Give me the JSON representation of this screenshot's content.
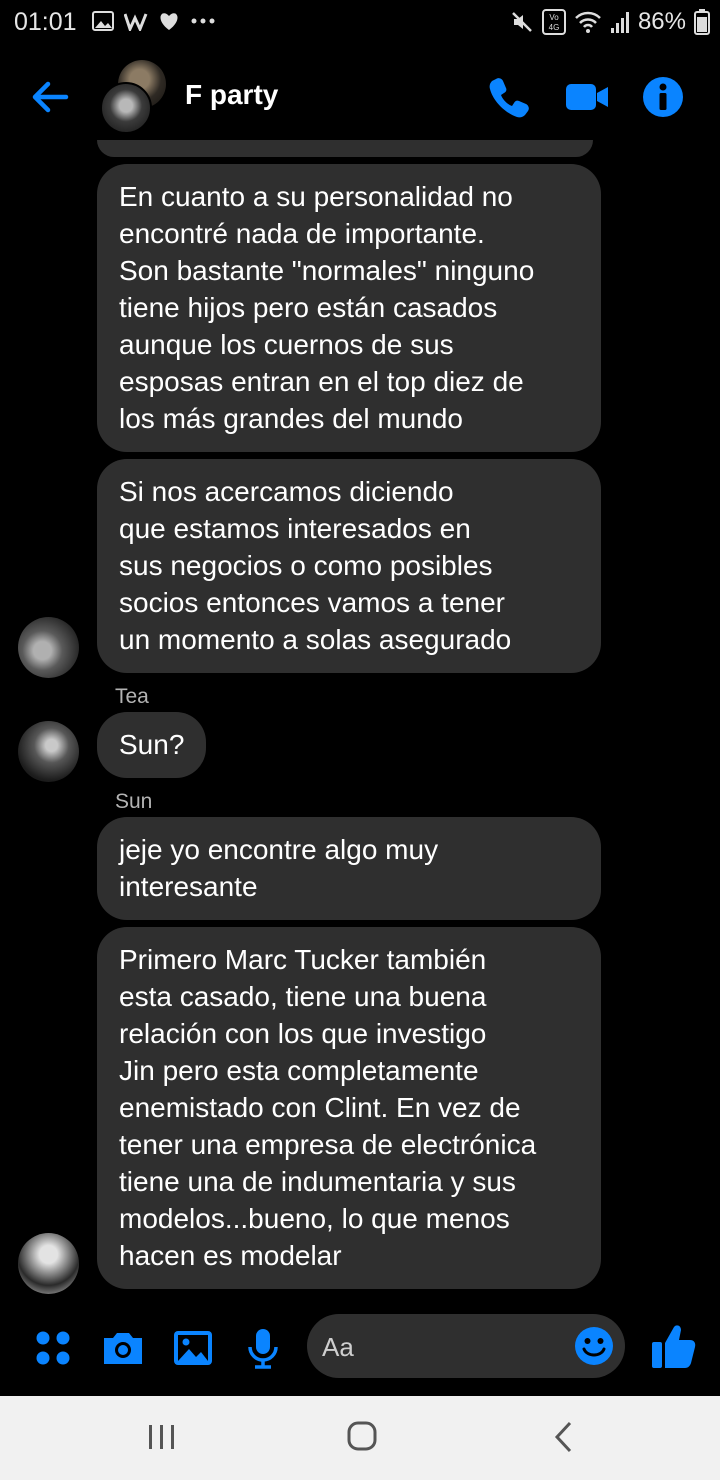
{
  "status_bar": {
    "time": "01:01",
    "battery": "86%",
    "left_icons": [
      "gallery-icon",
      "w-app-icon",
      "heart-icon",
      "more-dots-icon"
    ],
    "right_icons": [
      "mute-icon",
      "volte-4g-icon",
      "wifi-icon",
      "signal-icon",
      "battery-icon"
    ]
  },
  "header": {
    "title": "F party",
    "icons": [
      "back-arrow-icon",
      "phone-call-icon",
      "video-call-icon",
      "info-icon"
    ]
  },
  "messages": [
    {
      "id": "m1",
      "sender": "",
      "text": "En cuanto a su personalidad no\nencontré nada de importante.\nSon bastante \"normales\" ninguno\ntiene hijos pero están casados\naunque los cuernos de sus\nesposas entran en el top diez de\nlos más grandes del mundo"
    },
    {
      "id": "m2",
      "sender": "",
      "text": "Si nos acercamos diciendo\nque estamos interesados en\nsus negocios o como posibles\nsocios entonces vamos a tener\nun momento a solas asegurado"
    },
    {
      "id": "m3",
      "sender": "Tea",
      "text": "Sun?"
    },
    {
      "id": "m4",
      "sender": "Sun",
      "text": "jeje yo encontre algo muy\ninteresante"
    },
    {
      "id": "m5",
      "sender": "",
      "text": "Primero Marc Tucker también\nesta casado, tiene una buena\nrelación con los que investigo\nJin pero esta completamente\nenemistado con Clint. En vez de\ntener una empresa de electrónica\ntiene una de indumentaria y sus\nmodelos...bueno, lo que menos\nhacen es modelar"
    }
  ],
  "composer": {
    "placeholder": "Aa",
    "icons": [
      "menu-dots-icon",
      "camera-icon",
      "gallery-icon",
      "microphone-icon",
      "emoji-icon",
      "thumbs-up-icon"
    ]
  },
  "colors": {
    "accent": "#0a84ff",
    "bubble": "#2f2f2f",
    "background": "#000000",
    "navbar": "#f1f1f1"
  }
}
